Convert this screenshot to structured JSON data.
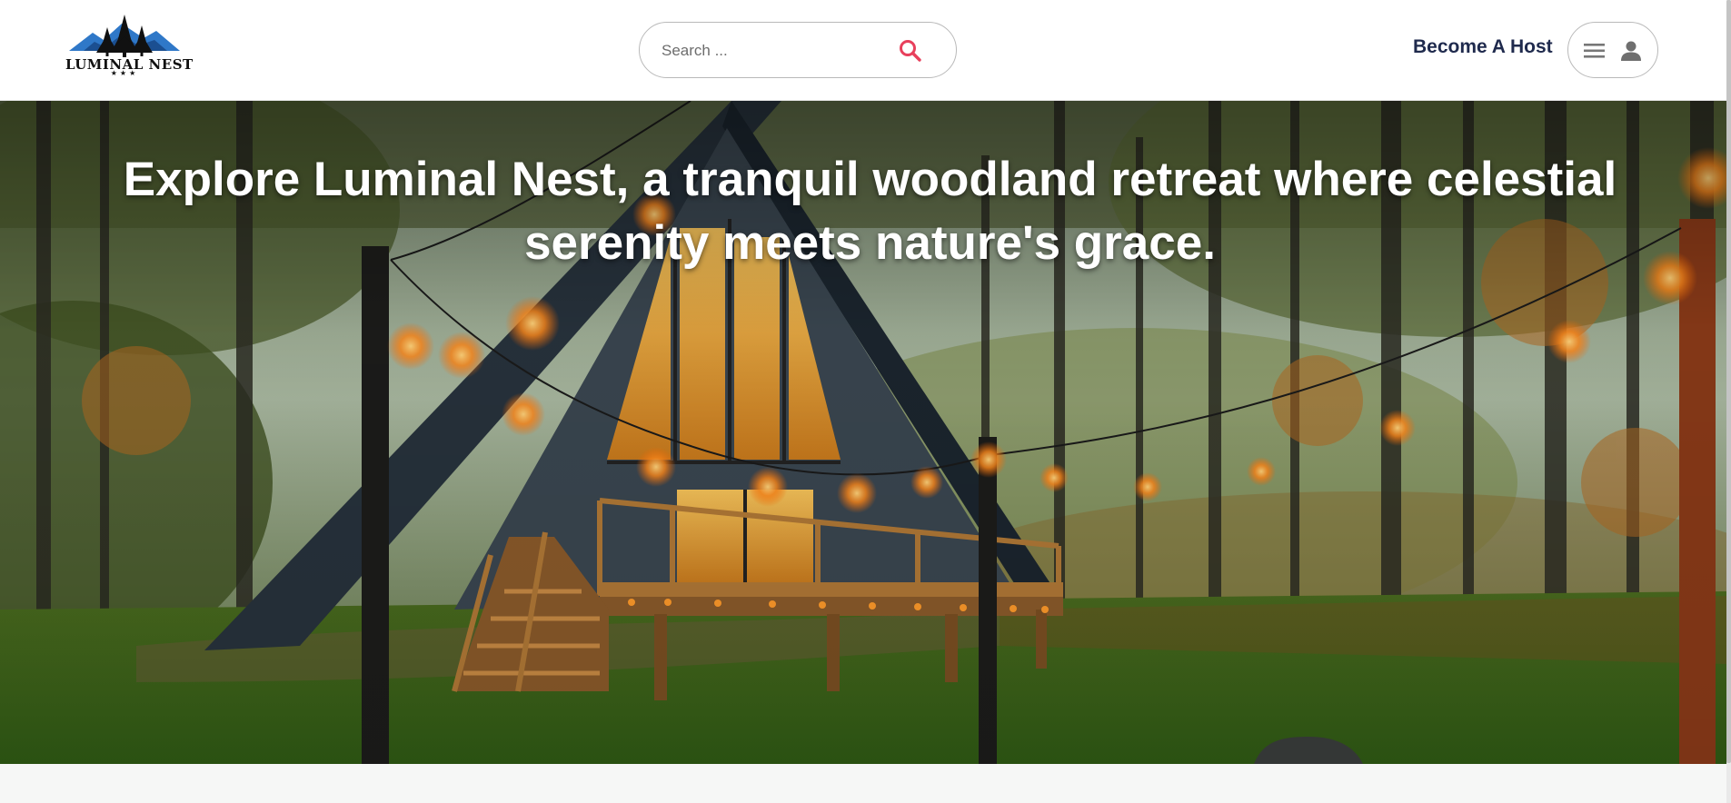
{
  "brand": {
    "name": "LUMINAL NEST",
    "stars": "★★★",
    "logo_icon": "pine-trees-mountain-logo"
  },
  "header": {
    "search": {
      "placeholder": "Search ...",
      "value": "",
      "icon": "search-icon",
      "icon_color": "#e8405c"
    },
    "become_host_label": "Become A Host",
    "user_menu": {
      "menu_icon": "hamburger-icon",
      "user_icon": "person-icon"
    }
  },
  "hero": {
    "title": "Explore Luminal Nest, a tranquil woodland retreat where celestial serenity meets nature's grace.",
    "background": "a-frame-cabin-in-woods-photo"
  },
  "colors": {
    "header_bg": "#ffffff",
    "link_text": "#1f2a4d",
    "accent": "#e8405c",
    "hero_text": "#ffffff",
    "page_bg": "#f6f7f6"
  }
}
